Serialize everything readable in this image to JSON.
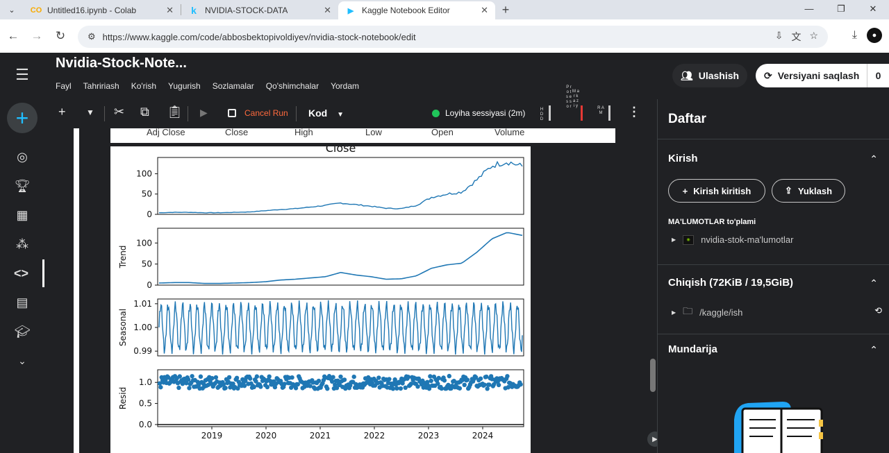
{
  "browser": {
    "tabs": [
      {
        "label": "Untitled16.ipynb - Colab",
        "icon": "colab-icon",
        "icon_text": "CO"
      },
      {
        "label": "NVIDIA-STOCK-DATA",
        "icon": "kaggle-icon",
        "icon_text": "k"
      },
      {
        "label": "Kaggle Notebook Editor",
        "icon": "kaggle-play-icon",
        "icon_text": "▶"
      }
    ],
    "url": "https://www.kaggle.com/code/abbosbektopivoldiyev/nvidia-stock-notebook/edit"
  },
  "notebook": {
    "title": "Nvidia-Stock-Note...",
    "menu": [
      "Fayl",
      "Tahririash",
      "Ko'rish",
      "Yugurish",
      "Sozlamalar",
      "Qo'shimchalar",
      "Yordam"
    ],
    "share_label": "Ulashish",
    "save_label": "Versiyani saqlash",
    "save_count": "0",
    "toolbar": {
      "cancel_run": "Cancel Run",
      "cell_type": "Kod",
      "session": "Loyiha sessiyasi (2m)",
      "meter1": "H D D",
      "meter2": "P r o t s e s s o r",
      "meter3": "M a r k a z i y",
      "meter4": "R A M"
    },
    "table_header": [
      "Adj Close",
      "Close",
      "High",
      "Low",
      "Open",
      "Volume"
    ]
  },
  "chart_data": {
    "type": "line",
    "title": "Close",
    "x": [
      "2019",
      "2020",
      "2021",
      "2022",
      "2023",
      "2024"
    ],
    "panels": [
      {
        "ylabel": "",
        "yticks": [
          "0",
          "50",
          "100"
        ],
        "ylim": [
          0,
          140
        ],
        "values": [
          4,
          5,
          5,
          4,
          4,
          5,
          6,
          9,
          12,
          14,
          18,
          22,
          28,
          24,
          20,
          15,
          14,
          22,
          42,
          50,
          55,
          85,
          120,
          130,
          118
        ]
      },
      {
        "ylabel": "Trend",
        "yticks": [
          "0",
          "50",
          "100"
        ],
        "ylim": [
          0,
          135
        ],
        "values": [
          5,
          6,
          6,
          4,
          4,
          5,
          6,
          8,
          12,
          14,
          17,
          20,
          30,
          24,
          20,
          14,
          15,
          22,
          40,
          48,
          52,
          78,
          110,
          125,
          118
        ]
      },
      {
        "ylabel": "Seasonal",
        "yticks": [
          "0.99",
          "1.00",
          "1.01"
        ],
        "ylim": [
          0.988,
          1.012
        ],
        "pattern": "periodic"
      },
      {
        "ylabel": "Resid",
        "yticks": [
          "0.0",
          "0.5",
          "1.0"
        ],
        "ylim": [
          -0.05,
          1.3
        ],
        "pattern": "noise around 1.0"
      }
    ],
    "colors": {
      "line": "#1f77b4"
    }
  },
  "panel": {
    "title": "Daftar",
    "input_section": "Kirish",
    "add_input": "Kirish kiritish",
    "upload": "Yuklash",
    "data_sub": "MA'LUMOTLAR to'plami",
    "dataset": "nvidia-stok-ma'lumotlar",
    "output_section": "Chiqish (72KiB / 19,5GiB)",
    "output_path": "/kaggle/ish",
    "toc_section": "Mundarija"
  }
}
